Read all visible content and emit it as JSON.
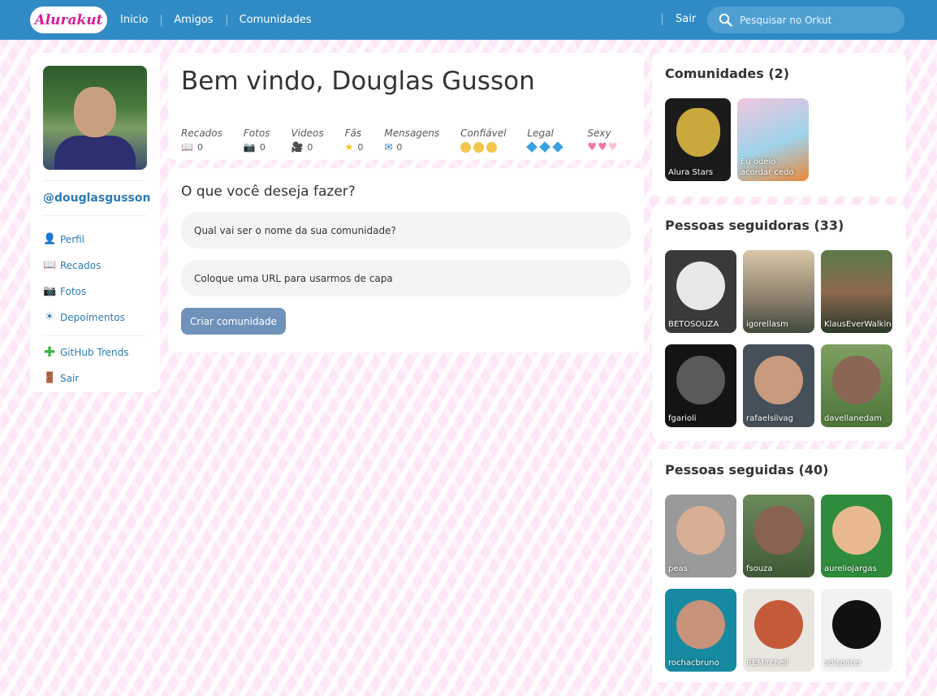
{
  "brand": "Alurakut",
  "nav": {
    "items": [
      "Inicio",
      "Amigos",
      "Comunidades"
    ],
    "logout": "Sair"
  },
  "search": {
    "placeholder": "Pesquisar no Orkut"
  },
  "profile": {
    "handle": "@douglasgusson",
    "menu": [
      {
        "label": "Perfil",
        "icon": "user-icon"
      },
      {
        "label": "Recados",
        "icon": "book-icon"
      },
      {
        "label": "Fotos",
        "icon": "camera-icon"
      },
      {
        "label": "Depoimentos",
        "icon": "sun-icon"
      }
    ],
    "menu2": [
      {
        "label": "GitHub Trends",
        "icon": "plus-icon"
      },
      {
        "label": "Sair",
        "icon": "door-icon"
      }
    ]
  },
  "welcome": {
    "title": "Bem vindo, Douglas Gusson",
    "stats": [
      {
        "label": "Recados",
        "value": "0",
        "icon": "book-icon"
      },
      {
        "label": "Fotos",
        "value": "0",
        "icon": "camera-icon"
      },
      {
        "label": "Videos",
        "value": "0",
        "icon": "video-camera-icon"
      },
      {
        "label": "Fãs",
        "value": "0",
        "icon": "star-icon"
      },
      {
        "label": "Mensagens",
        "value": "0",
        "icon": "mail-icon"
      }
    ],
    "ratings": [
      {
        "label": "Confiável",
        "icon": "smiley-icon",
        "count": 3
      },
      {
        "label": "Legal",
        "icon": "cube-icon",
        "count": 3
      },
      {
        "label": "Sexy",
        "icon": "heart-icon",
        "count": 3
      }
    ]
  },
  "form": {
    "heading": "O que você deseja fazer?",
    "name_placeholder": "Qual vai ser o nome da sua comunidade?",
    "url_placeholder": "Coloque uma URL para usarmos de capa",
    "submit": "Criar comunidade"
  },
  "communities": {
    "title": "Comunidades (2)",
    "items": [
      "Alura Stars",
      "Eu odeio acordar cedo"
    ]
  },
  "followers": {
    "title": "Pessoas seguidoras (33)",
    "items": [
      "BETOSOUZA",
      "igorellasm",
      "KlausEverWalking",
      "fgarioli",
      "rafaelsilvag",
      "davellanedam"
    ]
  },
  "following": {
    "title": "Pessoas seguidas (40)",
    "items": [
      "peas",
      "fsouza",
      "aureliojargas",
      "rochacbruno",
      "REMitchell",
      "sdispater"
    ]
  },
  "colors": {
    "topbar": "#308bc5",
    "link": "#2e7bb4",
    "button": "#6f92bb",
    "logo": "#d81d99"
  }
}
